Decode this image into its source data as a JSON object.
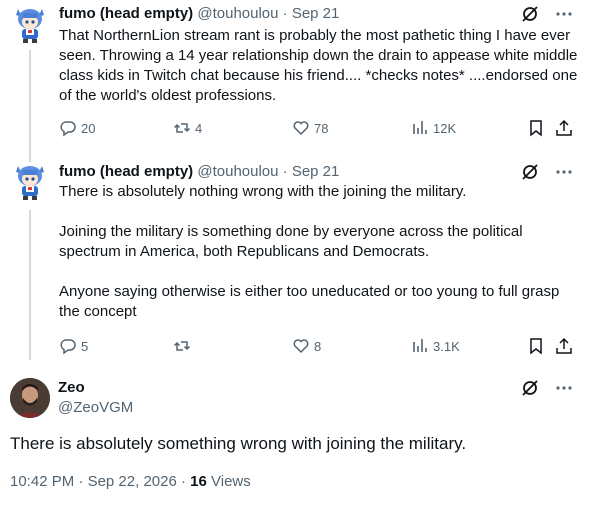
{
  "tweets": [
    {
      "display_name": "fumo (head empty)",
      "handle": "@touhoulou",
      "separator": "·",
      "date": "Sep 21",
      "paragraphs": [
        "That NorthernLion stream rant is probably the most pathetic thing I have ever seen. Throwing a 14 year relationship down the drain to appease white middle class kids in Twitch chat because his friend.... *checks notes* ....endorsed one of the world's oldest professions."
      ],
      "replies": "20",
      "reposts": "4",
      "likes": "78",
      "views": "12K"
    },
    {
      "display_name": "fumo (head empty)",
      "handle": "@touhoulou",
      "separator": "·",
      "date": "Sep 21",
      "paragraphs": [
        "There is absolutely nothing wrong with the joining the military.",
        "Joining the military is something done by everyone across the political spectrum in America, both Republicans and Democrats.",
        "Anyone saying otherwise is either too uneducated or too young to full grasp the concept"
      ],
      "replies": "5",
      "reposts": "",
      "likes": "8",
      "views": "3.1K"
    }
  ],
  "main_tweet": {
    "display_name": "Zeo",
    "handle": "@ZeoVGM",
    "text": "There is absolutely something wrong with joining the military.",
    "time": "10:42 PM",
    "separator": "·",
    "date": "Sep 22, 2026",
    "separator2": "·",
    "views_count": "16",
    "views_label": "Views"
  },
  "colors": {
    "text": "#0f1419",
    "secondary": "#536471",
    "thread_line": "#cfd9de",
    "avatar_blue": "#4a7fd6"
  },
  "icons": [
    "fumo-avatar-icon",
    "grok-icon",
    "more-icon",
    "reply-icon",
    "repost-icon",
    "like-icon",
    "views-icon",
    "bookmark-icon",
    "share-icon",
    "zeo-avatar"
  ]
}
